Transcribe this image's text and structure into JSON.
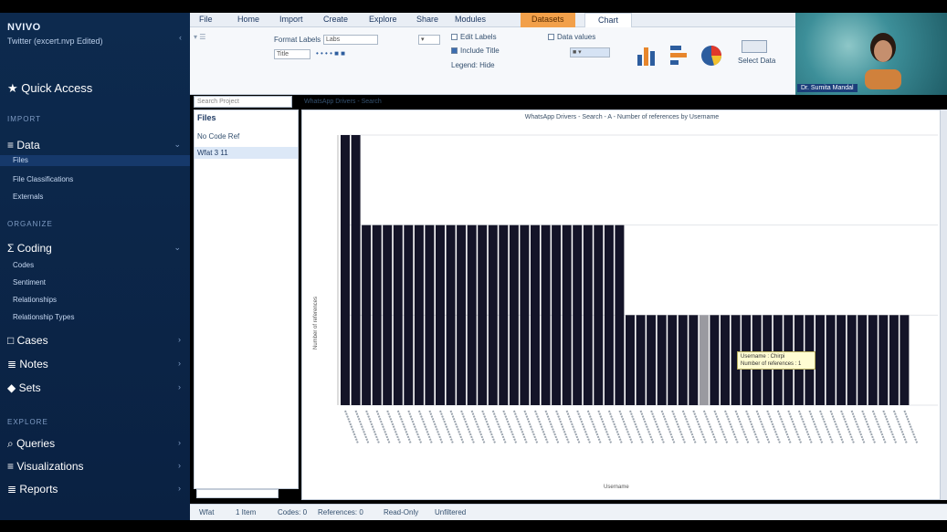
{
  "sidebar": {
    "brand": "NVIVO",
    "project": "Twitter (excert.nvp Edited)",
    "quick_access": "Quick Access",
    "sections": {
      "import": "IMPORT",
      "organize": "ORGANIZE",
      "explore": "EXPLORE"
    },
    "data": {
      "label": "Data",
      "items": [
        "Files",
        "File Classifications",
        "Externals"
      ]
    },
    "coding": {
      "label": "Coding",
      "items": [
        "Codes",
        "Sentiment",
        "Relationships",
        "Relationship Types"
      ]
    },
    "cases": "Cases",
    "notes": "Notes",
    "sets": "Sets",
    "queries": "Queries",
    "visualizations": "Visualizations",
    "reports": "Reports"
  },
  "ribbon": {
    "tabs": [
      "File",
      "Home",
      "Import",
      "Create",
      "Explore",
      "Share",
      "Modules"
    ],
    "context_tab": "Datasets",
    "active_tab": "Chart",
    "format_labels": "Format Labels",
    "format_labels_value": "Labs",
    "title_value": "Title",
    "edit_labels": "Edit Labels",
    "include_title": "Include Title",
    "legend": "Legend: Hide",
    "data_values": "Data values",
    "select_data": "Select Data"
  },
  "webcam": {
    "name": "Dr. Sumita Mandal"
  },
  "list_pane": {
    "search_placeholder": "Search Project",
    "title": "Files",
    "header": "No  Code  Ref",
    "row": "Wfat  3  11"
  },
  "detail_tab": "WhatsApp Drivers - Search",
  "chart_data": {
    "type": "bar",
    "title": "WhatsApp Drivers - Search - A - Number of references by Username",
    "xlabel": "Username",
    "ylabel": "Number of references",
    "ylim": [
      0,
      3
    ],
    "values": [
      3,
      3,
      2,
      2,
      2,
      2,
      2,
      2,
      2,
      2,
      2,
      2,
      2,
      2,
      2,
      2,
      2,
      2,
      2,
      2,
      2,
      2,
      2,
      2,
      2,
      2,
      2,
      1,
      1,
      1,
      1,
      1,
      1,
      1,
      1,
      1,
      1,
      1,
      1,
      1,
      1,
      1,
      1,
      1,
      1,
      1,
      1,
      1,
      1,
      1,
      1,
      1,
      1,
      1
    ],
    "highlight_index": 34,
    "bar_color": "#141428",
    "highlight_color": "#9a9aa0",
    "tooltip": [
      "Username : Chirpi",
      "Number of references : 1"
    ]
  },
  "status": {
    "items": [
      "Wfat",
      "1 Item",
      "Codes: 0",
      "References: 0",
      "Read-Only",
      "Unfiltered"
    ]
  }
}
